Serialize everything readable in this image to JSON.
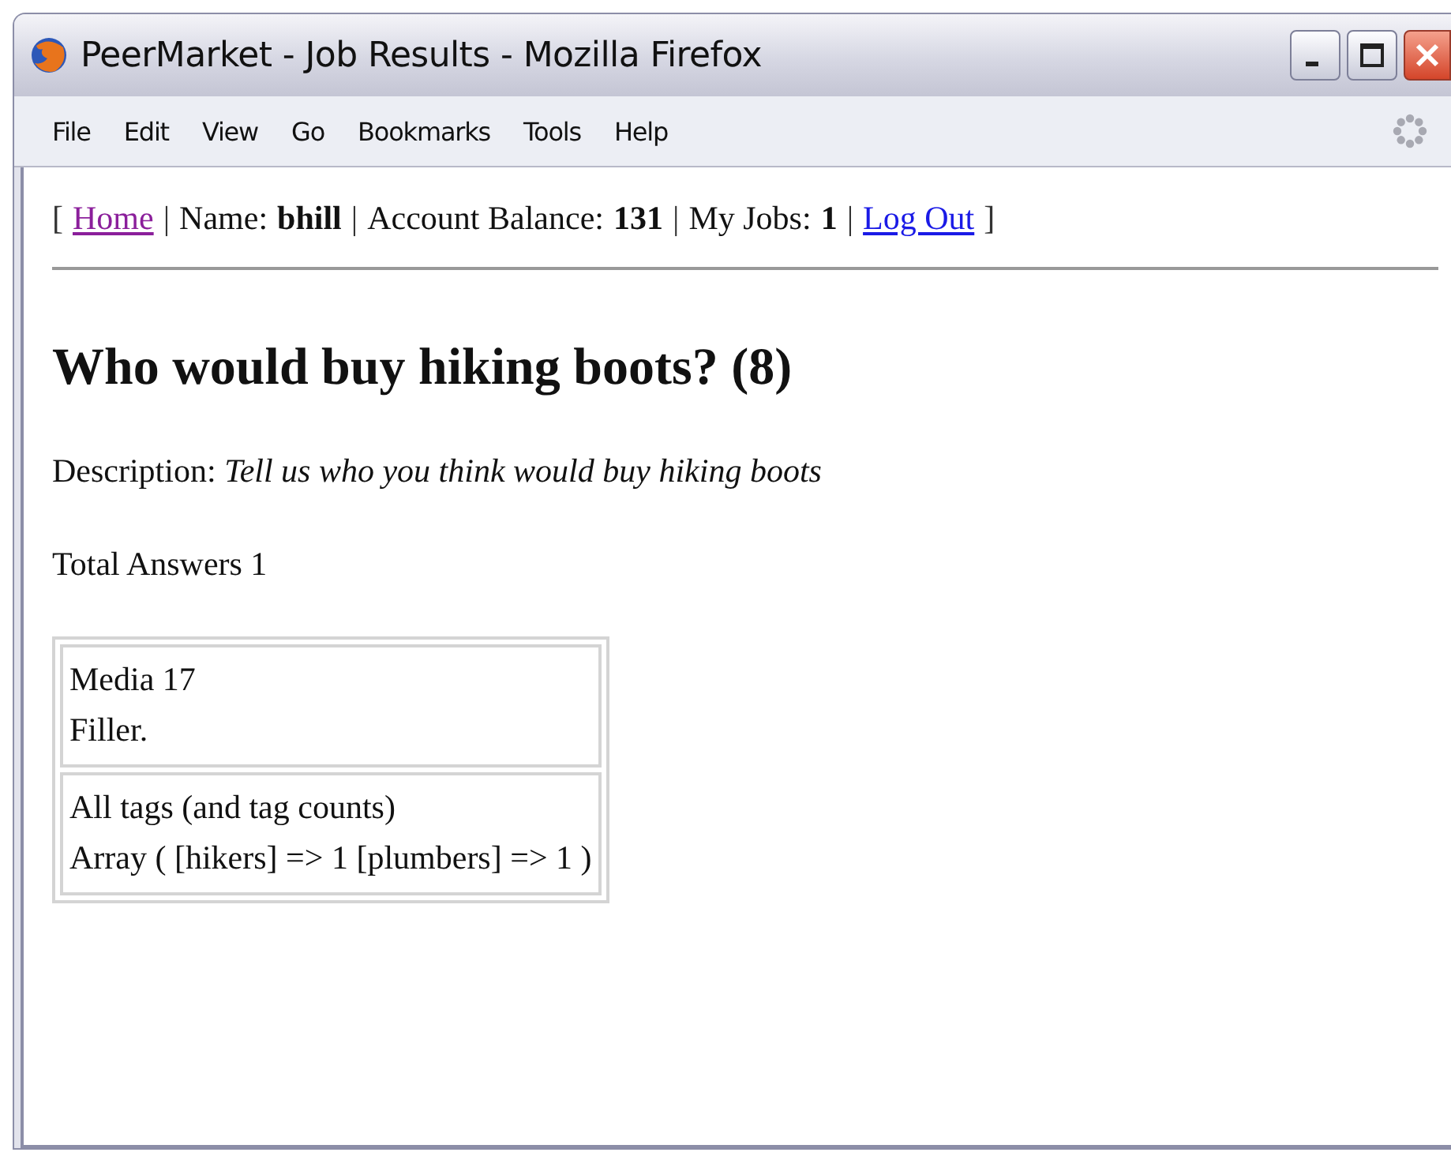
{
  "window": {
    "title": "PeerMarket - Job Results - Mozilla Firefox"
  },
  "menu": [
    {
      "label": "File"
    },
    {
      "label": "Edit"
    },
    {
      "label": "View"
    },
    {
      "label": "Go"
    },
    {
      "label": "Bookmarks"
    },
    {
      "label": "Tools"
    },
    {
      "label": "Help"
    }
  ],
  "nav": [
    {
      "kind": "punct",
      "text": "["
    },
    {
      "kind": "link",
      "text": "Home",
      "visited": true
    },
    {
      "kind": "punct",
      "text": "|"
    },
    {
      "kind": "label",
      "text": "Name:"
    },
    {
      "kind": "value",
      "text": "bhill"
    },
    {
      "kind": "punct",
      "text": "|"
    },
    {
      "kind": "label",
      "text": "Account Balance:"
    },
    {
      "kind": "value",
      "text": "131"
    },
    {
      "kind": "punct",
      "text": "|"
    },
    {
      "kind": "label",
      "text": "My Jobs:"
    },
    {
      "kind": "value",
      "text": "1"
    },
    {
      "kind": "punct",
      "text": "|"
    },
    {
      "kind": "link",
      "text": "Log Out",
      "visited": false
    },
    {
      "kind": "punct",
      "text": "]"
    }
  ],
  "heading": "Who would buy hiking boots? (8)",
  "description": "Description: *Tell us who you think would buy hiking boots*",
  "total_answers": "Total Answers 1",
  "table": {
    "rows": [
      {
        "lines": [
          "Media 17",
          "Filler."
        ]
      },
      {
        "lines": [
          "All tags (and tag counts)",
          "Array ( [hikers] => 1 [plumbers] => 1 )"
        ]
      }
    ]
  }
}
